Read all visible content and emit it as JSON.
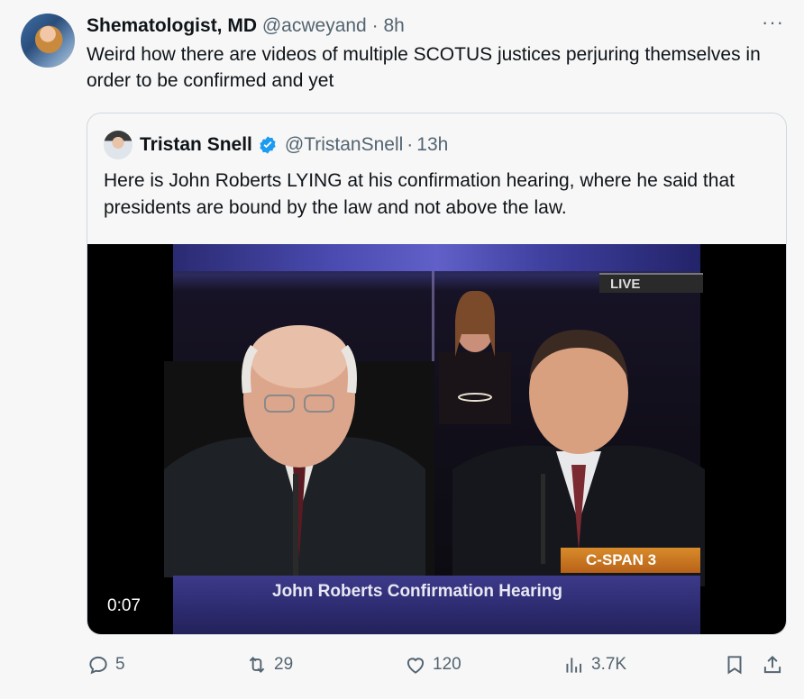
{
  "post": {
    "name": "Shematologist, MD",
    "handle": "@acweyand",
    "separator": "·",
    "time": "8h",
    "text": "Weird how there are videos of multiple SCOTUS justices perjuring themselves in order to be confirmed and yet",
    "more_label": "···"
  },
  "quote": {
    "name": "Tristan Snell",
    "handle": "@TristanSnell",
    "separator": "·",
    "time": "13h",
    "text": "Here is John Roberts LYING at his confirmation hearing, where he said that presidents are bound by the law and not above the law.",
    "video": {
      "live_label": "LIVE",
      "network_label": "C-SPAN 3",
      "lower_third": "John Roberts Confirmation Hearing",
      "timestamp": "0:07"
    }
  },
  "actions": {
    "replies": "5",
    "reposts": "29",
    "likes": "120",
    "views": "3.7K"
  },
  "colors": {
    "verified": "#1d9bf0",
    "muted": "#536471",
    "border": "#cfd9de"
  }
}
